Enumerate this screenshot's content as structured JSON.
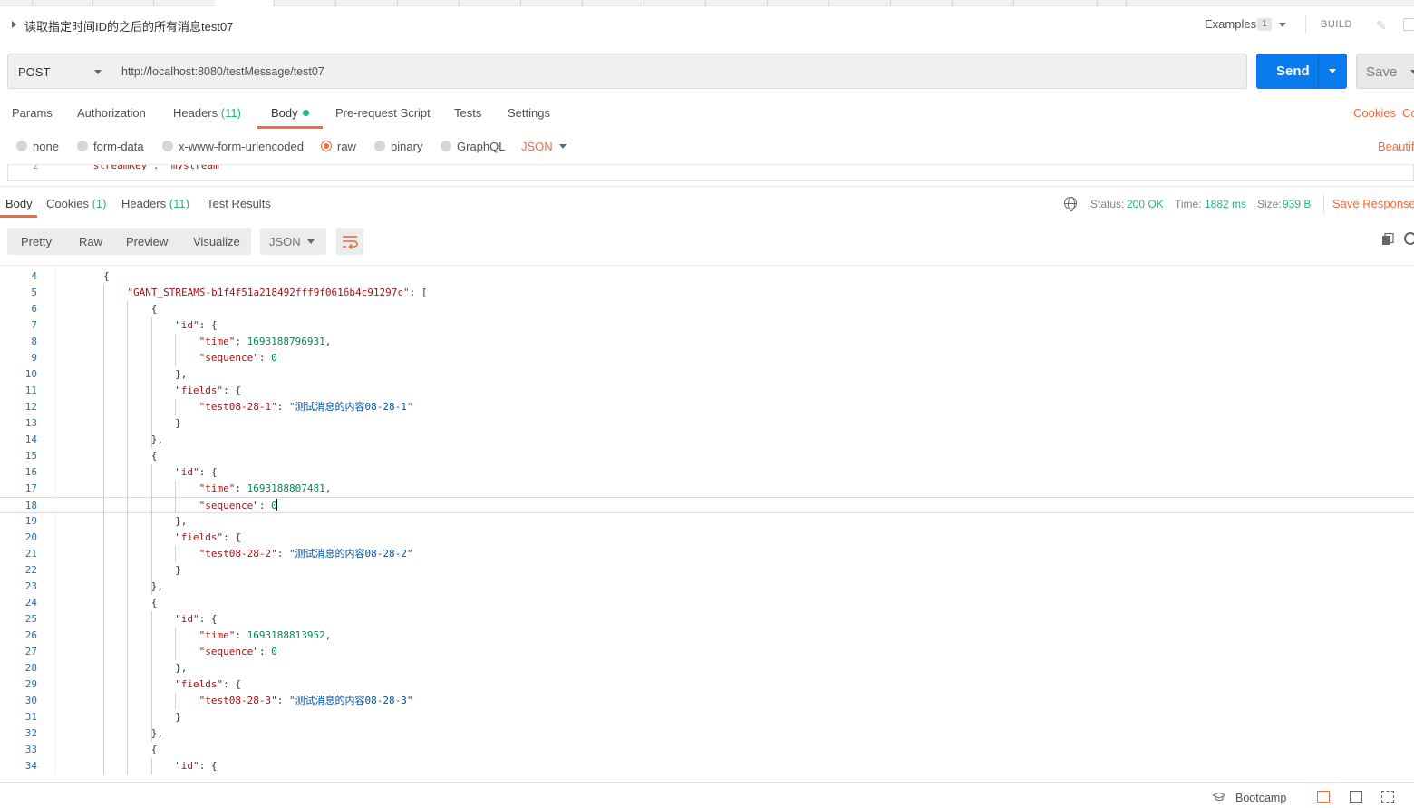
{
  "request": {
    "name": "读取指定时间ID的之后的所有消息test07",
    "examples_label": "Examples",
    "examples_count": "1",
    "build_label": "BUILD",
    "method": "POST",
    "url": "http://localhost:8080/testMessage/test07",
    "send_label": "Send",
    "save_label": "Save"
  },
  "request_tabs": {
    "params": "Params",
    "authorization": "Authorization",
    "headers": "Headers",
    "headers_count": "(11)",
    "body": "Body",
    "pre_request": "Pre-request Script",
    "tests": "Tests",
    "settings": "Settings",
    "cookies": "Cookies",
    "code": "Co"
  },
  "body_types": {
    "none": "none",
    "form_data": "form-data",
    "urlencoded": "x-www-form-urlencoded",
    "raw": "raw",
    "binary": "binary",
    "graphql": "GraphQL",
    "format": "JSON",
    "beautify": "Beautif",
    "selected": "raw"
  },
  "request_editor": {
    "visible_line_number": "2",
    "visible_line_text": "\"streamKey\": \"mystream\""
  },
  "response_tabs": {
    "body": "Body",
    "cookies": "Cookies",
    "cookies_count": "(1)",
    "headers": "Headers",
    "headers_count": "(11)",
    "test_results": "Test Results",
    "save_response": "Save Response"
  },
  "response_status": {
    "status_label": "Status:",
    "status_value": "200 OK",
    "time_label": "Time:",
    "time_value": "1882 ms",
    "size_label": "Size:",
    "size_value": "939 B"
  },
  "response_view": {
    "modes": [
      "Pretty",
      "Raw",
      "Preview",
      "Visualize"
    ],
    "format": "JSON"
  },
  "response_lines": [
    {
      "n": "4",
      "indent": 2,
      "parts": [
        [
          "p",
          "{"
        ]
      ]
    },
    {
      "n": "5",
      "indent": 3,
      "parts": [
        [
          "k",
          "\"GANT_STREAMS-b1f4f51a218492fff9f0616b4c91297c\""
        ],
        [
          "p",
          ": ["
        ]
      ]
    },
    {
      "n": "6",
      "indent": 4,
      "parts": [
        [
          "p",
          "{"
        ]
      ]
    },
    {
      "n": "7",
      "indent": 5,
      "parts": [
        [
          "k",
          "\"id\""
        ],
        [
          "p",
          ": {"
        ]
      ]
    },
    {
      "n": "8",
      "indent": 6,
      "parts": [
        [
          "k",
          "\"time\""
        ],
        [
          "p",
          ": "
        ],
        [
          "n",
          "1693188796931"
        ],
        [
          "p",
          ","
        ]
      ]
    },
    {
      "n": "9",
      "indent": 6,
      "parts": [
        [
          "k",
          "\"sequence\""
        ],
        [
          "p",
          ": "
        ],
        [
          "n",
          "0"
        ]
      ]
    },
    {
      "n": "10",
      "indent": 5,
      "parts": [
        [
          "p",
          "},"
        ]
      ]
    },
    {
      "n": "11",
      "indent": 5,
      "parts": [
        [
          "k",
          "\"fields\""
        ],
        [
          "p",
          ": {"
        ]
      ]
    },
    {
      "n": "12",
      "indent": 6,
      "parts": [
        [
          "k",
          "\"test08-28-1\""
        ],
        [
          "p",
          ": "
        ],
        [
          "s",
          "\"测试消息的内容08-28-1\""
        ]
      ]
    },
    {
      "n": "13",
      "indent": 5,
      "parts": [
        [
          "p",
          "}"
        ]
      ]
    },
    {
      "n": "14",
      "indent": 4,
      "parts": [
        [
          "p",
          "},"
        ]
      ]
    },
    {
      "n": "15",
      "indent": 4,
      "parts": [
        [
          "p",
          "{"
        ]
      ]
    },
    {
      "n": "16",
      "indent": 5,
      "parts": [
        [
          "k",
          "\"id\""
        ],
        [
          "p",
          ": {"
        ]
      ]
    },
    {
      "n": "17",
      "indent": 6,
      "parts": [
        [
          "k",
          "\"time\""
        ],
        [
          "p",
          ": "
        ],
        [
          "n",
          "1693188807481"
        ],
        [
          "p",
          ","
        ]
      ]
    },
    {
      "n": "18",
      "indent": 6,
      "parts": [
        [
          "k",
          "\"sequence\""
        ],
        [
          "p",
          ": "
        ],
        [
          "n",
          "0"
        ]
      ],
      "active": true
    },
    {
      "n": "19",
      "indent": 5,
      "parts": [
        [
          "p",
          "},"
        ]
      ]
    },
    {
      "n": "20",
      "indent": 5,
      "parts": [
        [
          "k",
          "\"fields\""
        ],
        [
          "p",
          ": {"
        ]
      ]
    },
    {
      "n": "21",
      "indent": 6,
      "parts": [
        [
          "k",
          "\"test08-28-2\""
        ],
        [
          "p",
          ": "
        ],
        [
          "s",
          "\"测试消息的内容08-28-2\""
        ]
      ]
    },
    {
      "n": "22",
      "indent": 5,
      "parts": [
        [
          "p",
          "}"
        ]
      ]
    },
    {
      "n": "23",
      "indent": 4,
      "parts": [
        [
          "p",
          "},"
        ]
      ]
    },
    {
      "n": "24",
      "indent": 4,
      "parts": [
        [
          "p",
          "{"
        ]
      ]
    },
    {
      "n": "25",
      "indent": 5,
      "parts": [
        [
          "k",
          "\"id\""
        ],
        [
          "p",
          ": {"
        ]
      ]
    },
    {
      "n": "26",
      "indent": 6,
      "parts": [
        [
          "k",
          "\"time\""
        ],
        [
          "p",
          ": "
        ],
        [
          "n",
          "1693188813952"
        ],
        [
          "p",
          ","
        ]
      ]
    },
    {
      "n": "27",
      "indent": 6,
      "parts": [
        [
          "k",
          "\"sequence\""
        ],
        [
          "p",
          ": "
        ],
        [
          "n",
          "0"
        ]
      ]
    },
    {
      "n": "28",
      "indent": 5,
      "parts": [
        [
          "p",
          "},"
        ]
      ]
    },
    {
      "n": "29",
      "indent": 5,
      "parts": [
        [
          "k",
          "\"fields\""
        ],
        [
          "p",
          ": {"
        ]
      ]
    },
    {
      "n": "30",
      "indent": 6,
      "parts": [
        [
          "k",
          "\"test08-28-3\""
        ],
        [
          "p",
          ": "
        ],
        [
          "s",
          "\"测试消息的内容08-28-3\""
        ]
      ]
    },
    {
      "n": "31",
      "indent": 5,
      "parts": [
        [
          "p",
          "}"
        ]
      ]
    },
    {
      "n": "32",
      "indent": 4,
      "parts": [
        [
          "p",
          "},"
        ]
      ]
    },
    {
      "n": "33",
      "indent": 4,
      "parts": [
        [
          "p",
          "{"
        ]
      ]
    },
    {
      "n": "34",
      "indent": 5,
      "parts": [
        [
          "k",
          "\"id\""
        ],
        [
          "p",
          ": {"
        ]
      ]
    }
  ],
  "statusbar": {
    "bootcamp": "Bootcamp"
  },
  "colors": {
    "accent": "#f26b3a",
    "send_blue": "#097bed",
    "success_green": "#26b47f",
    "json_key": "#a31515",
    "json_string": "#0451a5",
    "json_number": "#098658"
  },
  "icons": [
    "caret-right-icon",
    "chevron-down-icon",
    "pencil-icon",
    "comment-icon",
    "globe-icon",
    "wrap-lines-icon",
    "copy-icon",
    "search-icon",
    "bootcamp-icon",
    "two-pane-icon",
    "split-pane-icon",
    "keyboard-icon"
  ]
}
